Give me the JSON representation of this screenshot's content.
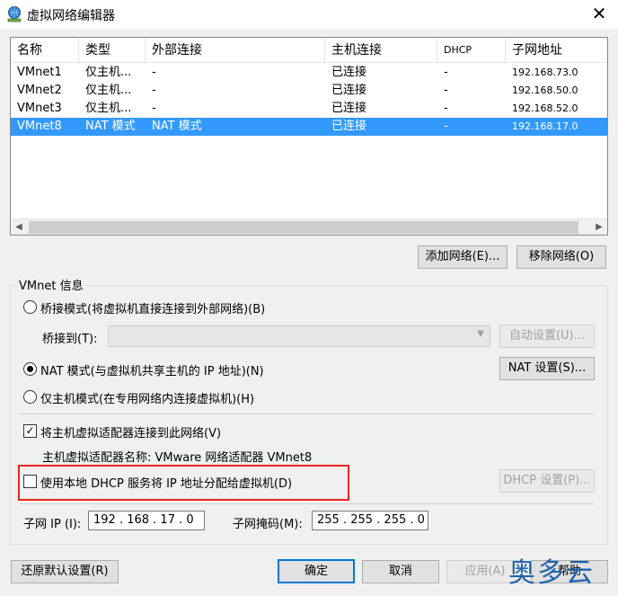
{
  "window": {
    "title": "虚拟网络编辑器",
    "close_glyph": "✕",
    "icon": "network-globe-icon"
  },
  "table": {
    "columns": [
      "名称",
      "类型",
      "外部连接",
      "主机连接",
      "DHCP",
      "子网地址"
    ],
    "rows": [
      {
        "name": "VMnet1",
        "type": "仅主机...",
        "external": "-",
        "host": "已连接",
        "dhcp": "-",
        "subnet": "192.168.73.0"
      },
      {
        "name": "VMnet2",
        "type": "仅主机...",
        "external": "-",
        "host": "已连接",
        "dhcp": "-",
        "subnet": "192.168.50.0"
      },
      {
        "name": "VMnet3",
        "type": "仅主机...",
        "external": "-",
        "host": "已连接",
        "dhcp": "-",
        "subnet": "192.168.52.0"
      },
      {
        "name": "VMnet8",
        "type": "NAT 模式",
        "external": "NAT 模式",
        "host": "已连接",
        "dhcp": "-",
        "subnet": "192.168.17.0"
      }
    ],
    "selected_row": "VMnet8"
  },
  "buttons": {
    "add_network": "添加网络(E)...",
    "remove_network": "移除网络(O)",
    "auto_settings": "自动设置(U)...",
    "nat_settings": "NAT 设置(S)...",
    "dhcp_settings": "DHCP 设置(P)...",
    "restore_defaults": "还原默认设置(R)",
    "ok": "确定",
    "cancel": "取消",
    "apply": "应用(A)",
    "help": "帮助"
  },
  "vmnet_info": {
    "group_title": "VMnet 信息",
    "bridge_mode": "桥接模式(将虚拟机直接连接到外部网络)(B)",
    "bridge_to_label": "桥接到(T):",
    "bridge_to_value": "",
    "nat_mode": "NAT 模式(与虚拟机共享主机的 IP 地址)(N)",
    "host_only_mode": "仅主机模式(在专用网络内连接虚拟机)(H)",
    "selected_mode": "nat",
    "connect_adapter": "将主机虚拟适配器连接到此网络(V)",
    "connect_adapter_checked": true,
    "adapter_name": "主机虚拟适配器名称: VMware 网络适配器 VMnet8",
    "use_dhcp": "使用本地 DHCP 服务将 IP 地址分配给虚拟机(D)",
    "use_dhcp_checked": false,
    "subnet_ip_label": "子网 IP (I):",
    "subnet_ip_value": "192 . 168 . 17 . 0",
    "subnet_mask_label": "子网掩码(M):",
    "subnet_mask_value": "255 . 255 . 255 . 0"
  },
  "watermark": "奥多云",
  "colors": {
    "selection": "#3399ff",
    "highlight_box": "#e8251d",
    "default_button_border": "#0078d7",
    "watermark": "#1e63ad"
  }
}
